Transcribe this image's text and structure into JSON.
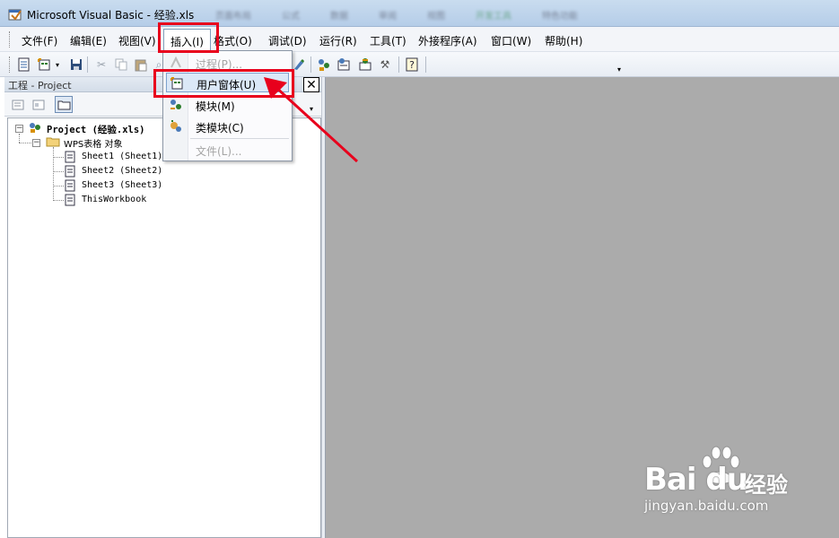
{
  "window": {
    "title": "Microsoft Visual Basic - 经验.xls",
    "background_tabs": [
      "页面布局",
      "公式",
      "数据",
      "审阅",
      "视图",
      "开发工具",
      "特色功能"
    ]
  },
  "menubar": {
    "items": [
      {
        "label": "文件(F)"
      },
      {
        "label": "编辑(E)"
      },
      {
        "label": "视图(V)"
      },
      {
        "label": "插入(I)",
        "open": true
      },
      {
        "label": "格式(O)"
      },
      {
        "label": "调试(D)"
      },
      {
        "label": "运行(R)"
      },
      {
        "label": "工具(T)"
      },
      {
        "label": "外接程序(A)"
      },
      {
        "label": "窗口(W)"
      },
      {
        "label": "帮助(H)"
      }
    ]
  },
  "insert_menu": {
    "items": [
      {
        "label": "过程(P)...",
        "enabled": false,
        "icon": "procedure-icon"
      },
      {
        "label": "用户窗体(U)",
        "enabled": true,
        "highlighted": true,
        "icon": "userform-icon"
      },
      {
        "label": "模块(M)",
        "enabled": true,
        "icon": "module-icon"
      },
      {
        "label": "类模块(C)",
        "enabled": true,
        "icon": "class-module-icon"
      },
      {
        "label": "文件(L)...",
        "enabled": false,
        "icon": ""
      }
    ]
  },
  "project_panel": {
    "title": "工程 - Project",
    "close_label": "✕",
    "tree": {
      "root": "Project (经验.xls)",
      "folder": "WPS表格 对象",
      "items": [
        "Sheet1 (Sheet1)",
        "Sheet2 (Sheet2)",
        "Sheet3 (Sheet3)",
        "ThisWorkbook"
      ]
    }
  },
  "watermark": {
    "logo": "Bai du",
    "brand_cn": "经验",
    "url": "jingyan.baidu.com"
  },
  "colors": {
    "highlight_box": "#e8001c",
    "workspace": "#ababab",
    "menu_hover": "#dbe8f7"
  }
}
